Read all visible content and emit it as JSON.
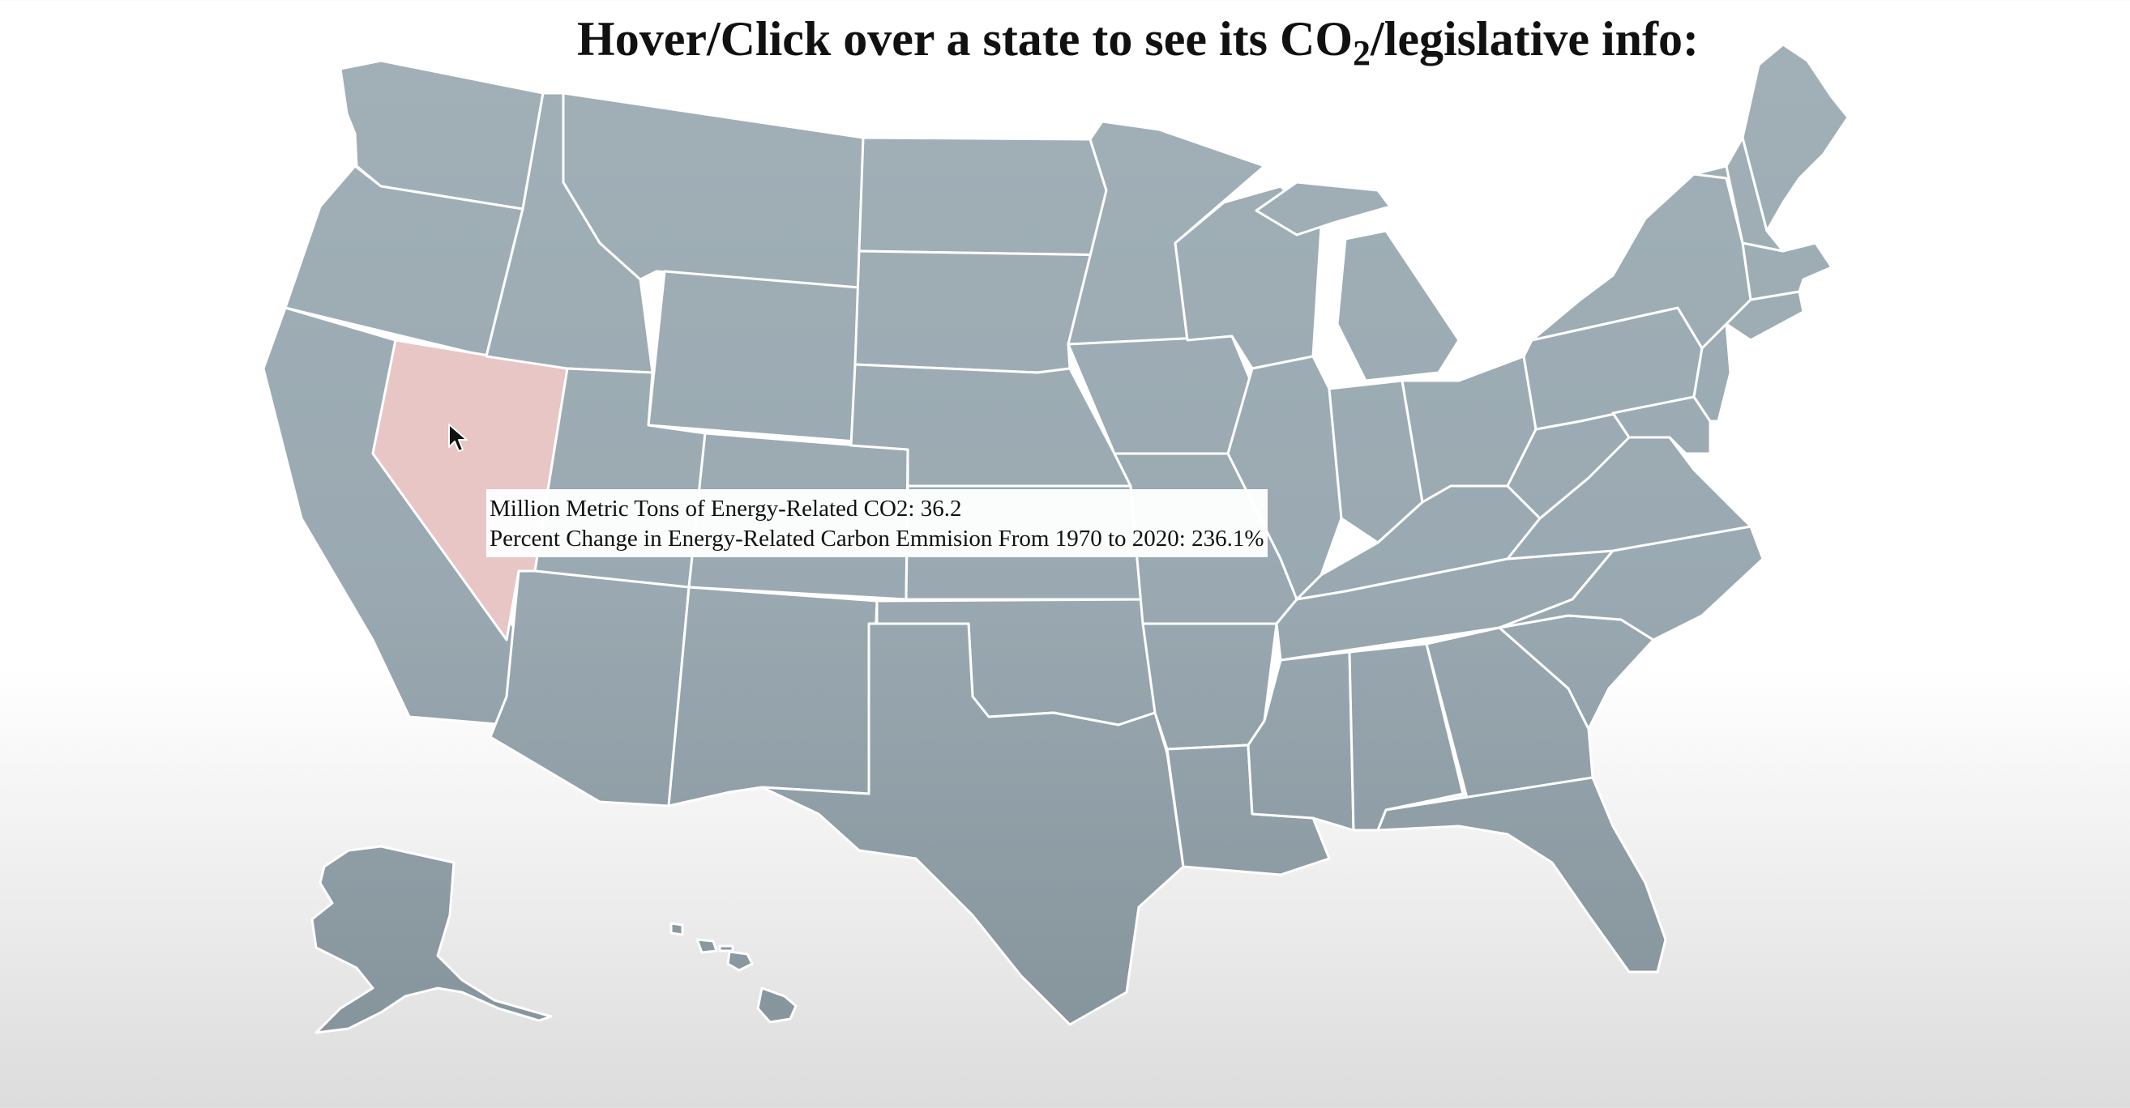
{
  "header": {
    "title_main": "Hover/Click over a state to see its CO",
    "title_sub": "2",
    "title_tail": "/legislative info:"
  },
  "map": {
    "highlighted_state": "Nevada",
    "colors": {
      "state_top": "#a1b0b7",
      "state_bottom": "#86949c",
      "highlight": "#e8c6c6",
      "border": "#ffffff"
    }
  },
  "tooltip": {
    "line1": "Million Metric Tons of Energy-Related CO2: 36.2",
    "line2": "Percent Change in Energy-Related Carbon Emmision From 1970 to 2020: 236.1%"
  },
  "cursor": {
    "icon": "arrow-pointer-icon"
  }
}
